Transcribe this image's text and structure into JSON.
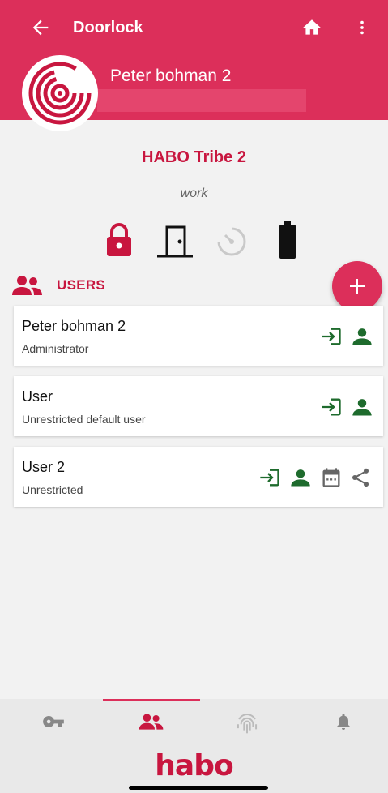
{
  "appbar": {
    "title": "Doorlock",
    "owner_name": "Peter bohman 2"
  },
  "lock": {
    "name": "HABO Tribe 2",
    "group": "work"
  },
  "status_icons": [
    "lock-closed-icon",
    "door-closed-icon",
    "auto-lock-icon",
    "battery-full-icon"
  ],
  "users_section": {
    "label": "USERS",
    "add_icon": "plus-icon"
  },
  "users": [
    {
      "name": "Peter bohman 2",
      "role": "Administrator",
      "icons": [
        "login-icon",
        "person-icon"
      ]
    },
    {
      "name": "User",
      "role": "Unrestricted default user",
      "icons": [
        "login-icon",
        "person-icon"
      ]
    },
    {
      "name": "User 2",
      "role": "Unrestricted",
      "icons": [
        "login-icon",
        "person-icon",
        "calendar-icon",
        "share-icon"
      ]
    }
  ],
  "bottom_nav": {
    "tabs": [
      "key-icon",
      "users-icon",
      "fingerprint-icon",
      "bell-icon"
    ],
    "selected": "users-icon"
  },
  "footer": {
    "brand": "habo"
  },
  "colors": {
    "brand": "#dc2f5a",
    "accent_text": "#c8163f",
    "status_green": "#1e6b2d"
  }
}
